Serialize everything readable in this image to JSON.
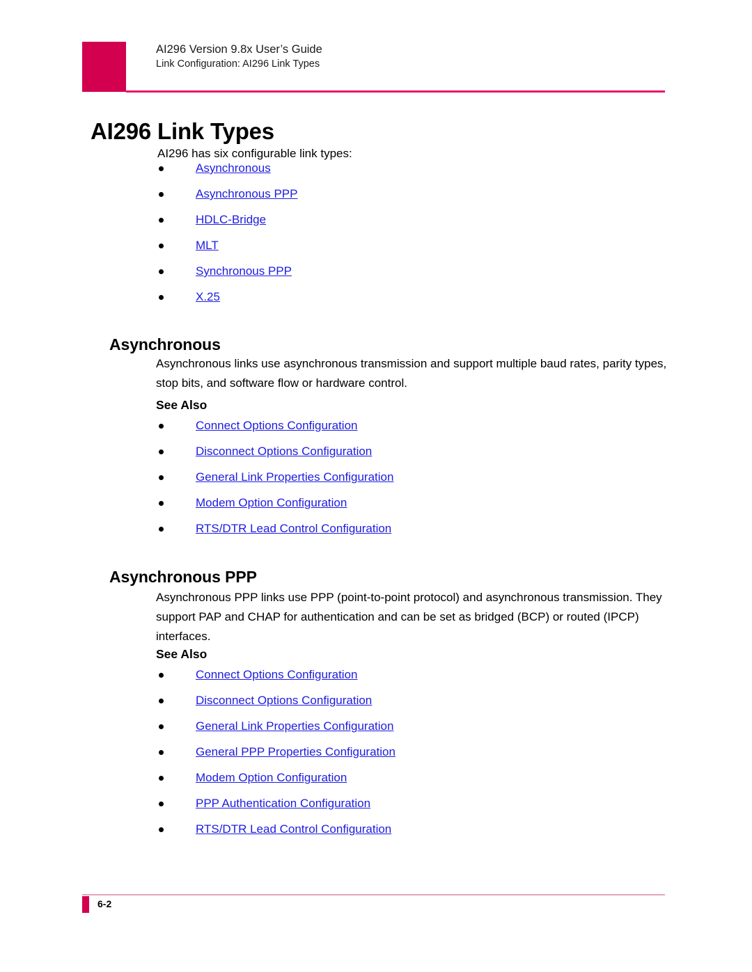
{
  "header": {
    "line1": "AI296 Version 9.8x User’s Guide",
    "line2": "Link Configuration: AI296 Link Types",
    "accent_color": "#D2004F",
    "rule_color": "#E8126B"
  },
  "page_title": "AI296 Link Types",
  "intro": "AI296 has six configurable link types:",
  "link_types": [
    {
      "label": "Asynchronous"
    },
    {
      "label": "Asynchronous PPP"
    },
    {
      "label": "HDLC-Bridge"
    },
    {
      "label": "MLT"
    },
    {
      "label": "Synchronous PPP"
    },
    {
      "label": "X.25"
    }
  ],
  "sections": [
    {
      "heading": "Asynchronous",
      "body": "Asynchronous links use asynchronous transmission and support multiple baud rates, parity types, stop bits, and software flow or hardware control.",
      "see_also_label": "See Also",
      "see_also": [
        {
          "label": "Connect Options Configuration"
        },
        {
          "label": "Disconnect Options Configuration"
        },
        {
          "label": "General Link Properties Configuration"
        },
        {
          "label": "Modem Option Configuration"
        },
        {
          "label": "RTS/DTR Lead Control Configuration"
        }
      ]
    },
    {
      "heading": "Asynchronous PPP",
      "body": "Asynchronous PPP links use PPP (point-to-point protocol) and asynchronous transmission. They support PAP and CHAP for authentication and can be set as bridged (BCP) or routed (IPCP) interfaces.",
      "see_also_label": "See Also",
      "see_also": [
        {
          "label": "Connect Options Configuration"
        },
        {
          "label": "Disconnect Options Configuration"
        },
        {
          "label": "General Link Properties Configuration"
        },
        {
          "label": "General PPP Properties Configuration"
        },
        {
          "label": "Modem Option Configuration"
        },
        {
          "label": "PPP Authentication Configuration"
        },
        {
          "label": "RTS/DTR Lead Control Configuration"
        }
      ]
    }
  ],
  "footer": {
    "page_number": "6-2",
    "accent_color": "#D2004F",
    "rule_color": "#E5A3BF"
  },
  "link_color": "#1C1CE0"
}
